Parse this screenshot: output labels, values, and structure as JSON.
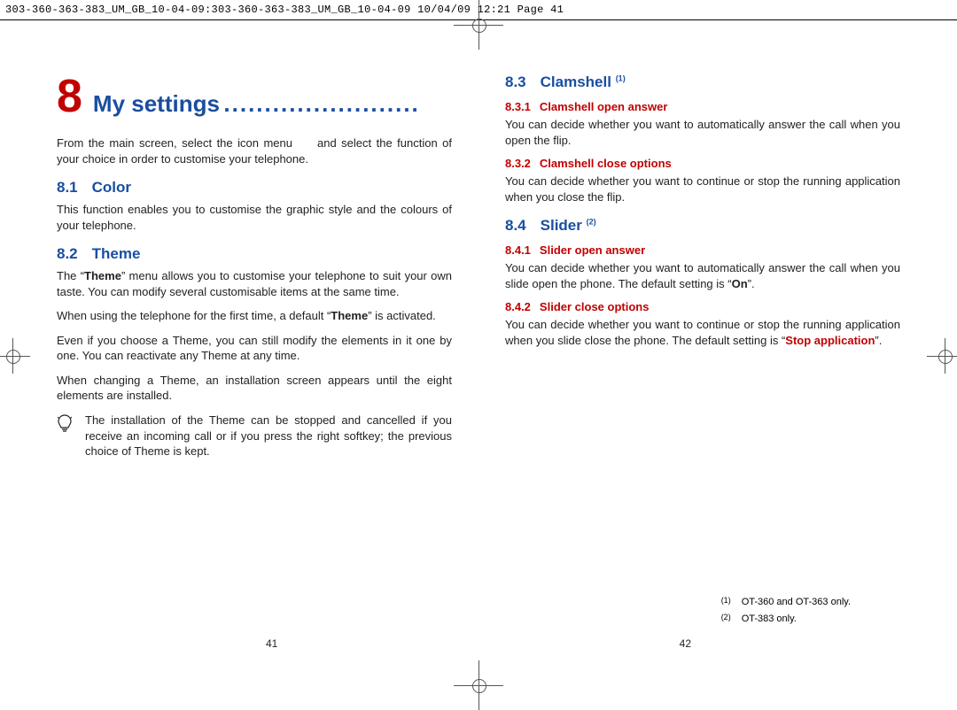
{
  "header": "303-360-363-383_UM_GB_10-04-09:303-360-363-383_UM_GB_10-04-09  10/04/09  12:21  Page 41",
  "chapter": {
    "number": "8",
    "title": "My settings",
    "dots": "........................"
  },
  "left": {
    "intro_a": "From the main screen, select the icon menu",
    "intro_b": "and select the function of your choice in order to customise your telephone.",
    "s81": {
      "num": "8.1",
      "title": "Color",
      "body": "This function enables you to customise the graphic style and the colours of your telephone."
    },
    "s82": {
      "num": "8.2",
      "title": "Theme",
      "p1a": "The “",
      "p1b": "” menu allows you to customise your telephone to suit your own taste. You can modify several customisable items at the same time.",
      "p2a": "When using the telephone for the first time, a default “",
      "p2b": "” is activated.",
      "p3": "Even if you choose a Theme, you can still modify the elements in it one by one. You can reactivate any Theme at any time.",
      "p4": "When changing a Theme, an installation screen appears until the eight elements are installed.",
      "tip": "The installation of the Theme can be stopped and cancelled if you receive an incoming call or if you press the right softkey; the previous choice of Theme is kept.",
      "theme_word": "Theme"
    }
  },
  "right": {
    "s83": {
      "num": "8.3",
      "title": "Clamshell",
      "sup": "(1)",
      "s831": {
        "num": "8.3.1",
        "title": "Clamshell open answer",
        "body": "You can decide whether you want to automatically answer the call when you open the flip."
      },
      "s832": {
        "num": "8.3.2",
        "title": "Clamshell close options",
        "body": "You can decide whether you want to continue or stop the running application when you close the flip."
      }
    },
    "s84": {
      "num": "8.4",
      "title": "Slider",
      "sup": "(2)",
      "s841": {
        "num": "8.4.1",
        "title": "Slider open answer",
        "body_a": "You can decide whether you want to automatically answer the call when you slide open the phone. The default setting is “",
        "body_on": "On",
        "body_b": "”."
      },
      "s842": {
        "num": "8.4.2",
        "title": "Slider close options",
        "body_a": "You can decide whether you want to continue or stop the running application when you slide close the phone. The default setting is “",
        "body_stop": "Stop application",
        "body_b": "”."
      }
    },
    "footnotes": {
      "f1": {
        "mark": "(1)",
        "text": "OT-360 and OT-363 only."
      },
      "f2": {
        "mark": "(2)",
        "text": "OT-383 only."
      }
    }
  },
  "pages": {
    "left": "41",
    "right": "42"
  }
}
